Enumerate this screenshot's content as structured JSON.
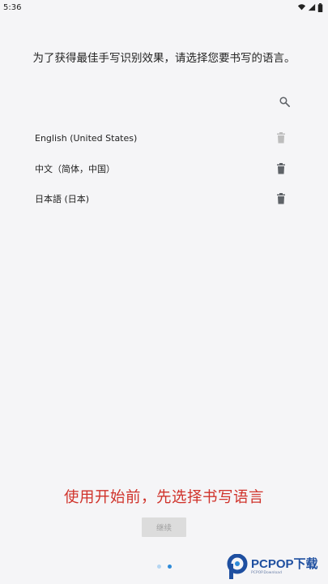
{
  "status_bar": {
    "time": "5:36",
    "icons": [
      "wifi-icon",
      "signal-icon",
      "battery-icon"
    ]
  },
  "instruction": "为了获得最佳手写识别效果，请选择您要书写的语言。",
  "languages": [
    {
      "label": "English (United States)",
      "delete_enabled": false
    },
    {
      "label": "中文（简体，中国）",
      "delete_enabled": true
    },
    {
      "label": "日本語 (日本)",
      "delete_enabled": true
    }
  ],
  "promo": "使用开始前，先选择书写语言",
  "continue_label": "继续",
  "pager": {
    "count": 2,
    "active_index": 1
  },
  "watermark": {
    "brand": "PCPOP下载",
    "tagline": "PCPOP.Download"
  },
  "colors": {
    "background": "#f5f5f7",
    "promo": "#d0332b",
    "icon": "#5f6368",
    "icon_disabled": "#bdbdbd",
    "pager_active": "#2d8ad8",
    "pager_inactive": "#b5d6f2"
  }
}
